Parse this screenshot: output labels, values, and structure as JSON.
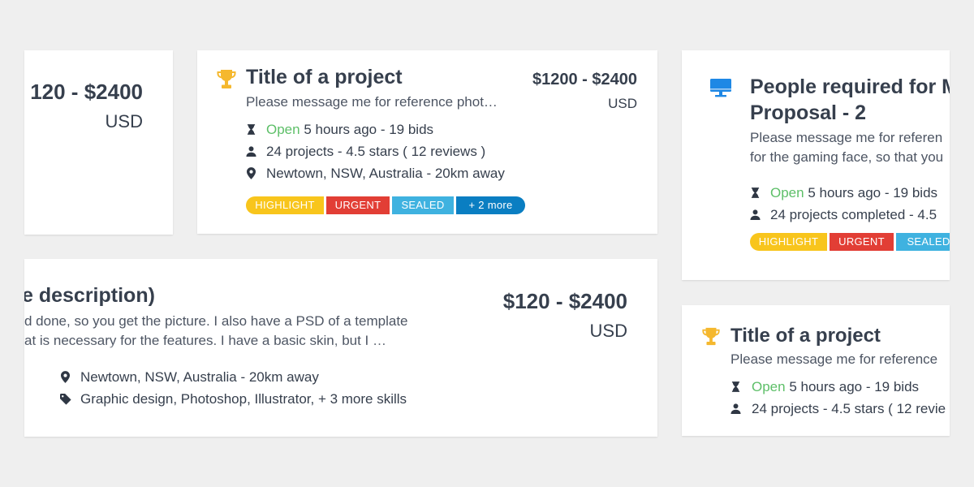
{
  "colors": {
    "background": "#efefef",
    "open": "#5dbf68",
    "highlight": "#f8c51c",
    "urgent": "#e23e35",
    "sealed": "#3fb2e0",
    "more": "#0a7ec2",
    "trophy": "#f5b82e",
    "monitor": "#1e88e5"
  },
  "card_left_top": {
    "price": "120 - $2400",
    "currency": "USD"
  },
  "card_center_top": {
    "icon": "trophy-icon",
    "title": "Title of a project",
    "description": "Please message me for reference phot…",
    "price": "$1200 - $2400",
    "currency": "USD",
    "status_open": "Open",
    "status_rest": " 5 hours ago - 19 bids",
    "projects": "24 projects - 4.5 stars ( 12 reviews )",
    "location": "Newtown, NSW, Australia - 20km away",
    "tags": {
      "highlight": "HIGHLIGHT",
      "urgent": "URGENT",
      "sealed": "SEALED",
      "more": "+ 2 more"
    }
  },
  "card_right_top": {
    "icon": "monitor-icon",
    "title_line1": "People required for M",
    "title_line2": "Proposal - 2",
    "desc_line1": "Please message me for referen",
    "desc_line2": "for the gaming face, so that you",
    "status_open": "Open",
    "status_rest": " 5 hours ago - 19 bids",
    "projects": "24 projects completed - 4.5",
    "tags": {
      "highlight": "HIGHLIGHT",
      "urgent": "URGENT",
      "sealed": "SEALED"
    }
  },
  "card_wide": {
    "title": "e description)",
    "desc_line1": "d done, so you get the picture. I also have a PSD of a template",
    "desc_line2": "at is necessary for the features. I have a  basic skin, but I …",
    "price": "$120 - $2400",
    "currency": "USD",
    "location": "Newtown, NSW, Australia - 20km away",
    "skills": "Graphic design, Photoshop, Illustrator, + 3 more skills"
  },
  "card_right_bottom": {
    "icon": "trophy-icon",
    "title": "Title of a project",
    "description": "Please message me for reference",
    "status_open": "Open",
    "status_rest": " 5 hours ago - 19 bids",
    "projects": "24 projects - 4.5 stars ( 12 revie"
  }
}
